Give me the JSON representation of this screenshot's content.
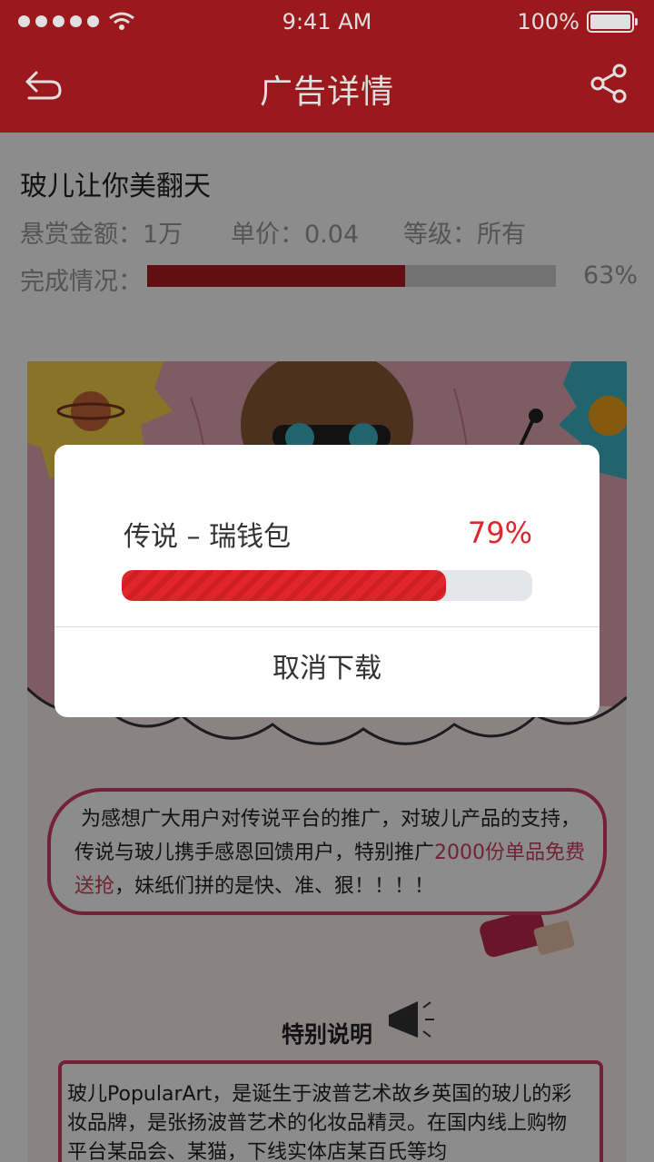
{
  "status_bar": {
    "time": "9:41 AM",
    "battery": "100%",
    "signal_icon": "signal-dots-icon",
    "wifi_icon": "wifi-icon",
    "battery_icon": "battery-icon"
  },
  "nav": {
    "title": "广告详情",
    "back_icon": "back-arrow-icon",
    "share_icon": "share-icon"
  },
  "ad": {
    "title": "玻儿让你美翻天",
    "reward": "悬赏金额：1万",
    "unit_price": "单价：0.04",
    "level": "等级：所有",
    "progress_label": "完成情况：",
    "progress_pct_text": "63%",
    "progress_value": 0.63
  },
  "poster": {
    "intro_prefix": "为感想广大用户对传说平台的推广，对玻儿产品的支持，传说与玻儿携手感恩回馈用户，特别推广",
    "intro_highlight": "2000份单品免费送抢",
    "intro_suffix": "，妹纸们拼的是快、准、狠！！！！",
    "special_title": "特别说明",
    "special_text": "玻儿PopularArt，是诞生于波普艺术故乡英国的玻儿的彩妆品牌，是张扬波普艺术的化妆品精灵。在国内线上购物平台某品会、某猫，下线实体店某百氏等均"
  },
  "download_dialog": {
    "app_name": "传说 – 瑞钱包",
    "percent_text": "79%",
    "percent_value": 0.79,
    "cancel_label": "取消下载"
  },
  "colors": {
    "brand_red": "#b11d20",
    "progress_red": "#e0262c",
    "highlight_pink": "#d23d63"
  }
}
